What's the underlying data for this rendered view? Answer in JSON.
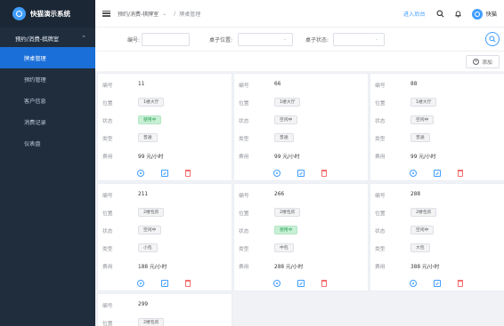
{
  "app": {
    "title": "快猫演示系统"
  },
  "sidebar": {
    "group_label": "预约/消费-棋牌室",
    "items": [
      {
        "label": "牌桌管理",
        "active": true
      },
      {
        "label": "预约管理",
        "active": false
      },
      {
        "label": "客户信息",
        "active": false
      },
      {
        "label": "消费记录",
        "active": false
      },
      {
        "label": "仪表盘",
        "active": false
      }
    ]
  },
  "header": {
    "breadcrumb": [
      "预约/消费-棋牌室",
      "牌桌管理"
    ],
    "admin_link": "进入后台",
    "username": "快猫"
  },
  "filters": {
    "number_label": "编号:",
    "position_label": "桌子位置:",
    "status_label": "桌子状态:"
  },
  "toolbar": {
    "add_label": "添加"
  },
  "field_labels": {
    "number": "编号",
    "position": "位置",
    "status": "状态",
    "type": "类型",
    "price": "费用"
  },
  "tables": [
    {
      "number": "11",
      "position": "1楼大厅",
      "status": "使用中",
      "type": "普通",
      "price": "99 元/小时"
    },
    {
      "number": "66",
      "position": "1楼大厅",
      "status": "空闲中",
      "type": "普通",
      "price": "99 元/小时"
    },
    {
      "number": "88",
      "position": "1楼大厅",
      "status": "空闲中",
      "type": "普通",
      "price": "99 元/小时"
    },
    {
      "number": "211",
      "position": "2楼包房",
      "status": "空闲中",
      "type": "小包",
      "price": "188 元/小时"
    },
    {
      "number": "266",
      "position": "2楼包房",
      "status": "使用中",
      "type": "中包",
      "price": "288 元/小时"
    },
    {
      "number": "288",
      "position": "2楼包房",
      "status": "空闲中",
      "type": "大包",
      "price": "388 元/小时"
    },
    {
      "number": "299",
      "position": "2楼包房",
      "status": "",
      "type": "",
      "price": ""
    }
  ],
  "colors": {
    "accent": "#409eff",
    "sidebar": "#1f2d3d",
    "active": "#1b6fd8",
    "in_use": "#2ea35a",
    "danger": "#f56c6c"
  }
}
